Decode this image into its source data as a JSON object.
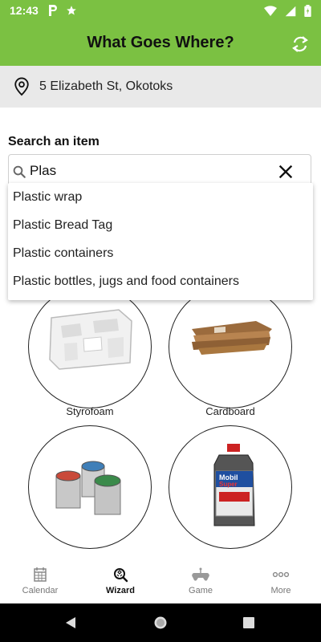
{
  "status": {
    "time": "12:43"
  },
  "app": {
    "title": "What Goes Where?"
  },
  "address": {
    "text": "5 Elizabeth St, Okotoks"
  },
  "search": {
    "label": "Search an item",
    "value": "Plas",
    "suggestions": [
      "Plastic wrap",
      "Plastic Bread Tag",
      "Plastic containers",
      "Plastic bottles, jugs and food containers"
    ]
  },
  "items": [
    {
      "label": "Styrofoam"
    },
    {
      "label": "Cardboard"
    },
    {
      "label": ""
    },
    {
      "label": ""
    }
  ],
  "paint": {
    "colors": [
      "#c94a3a",
      "#3f7fb8",
      "#3a8a4a"
    ]
  },
  "oil_brand": {
    "line1": "Mobil",
    "line2": "Super"
  },
  "nav": {
    "items": [
      {
        "label": "Calendar",
        "icon": "calendar-icon"
      },
      {
        "label": "Wizard",
        "icon": "wizard-icon"
      },
      {
        "label": "Game",
        "icon": "gamepad-icon"
      },
      {
        "label": "More",
        "icon": "more-icon"
      }
    ],
    "active": "Wizard"
  },
  "theme": {
    "accent": "#7bc142"
  }
}
